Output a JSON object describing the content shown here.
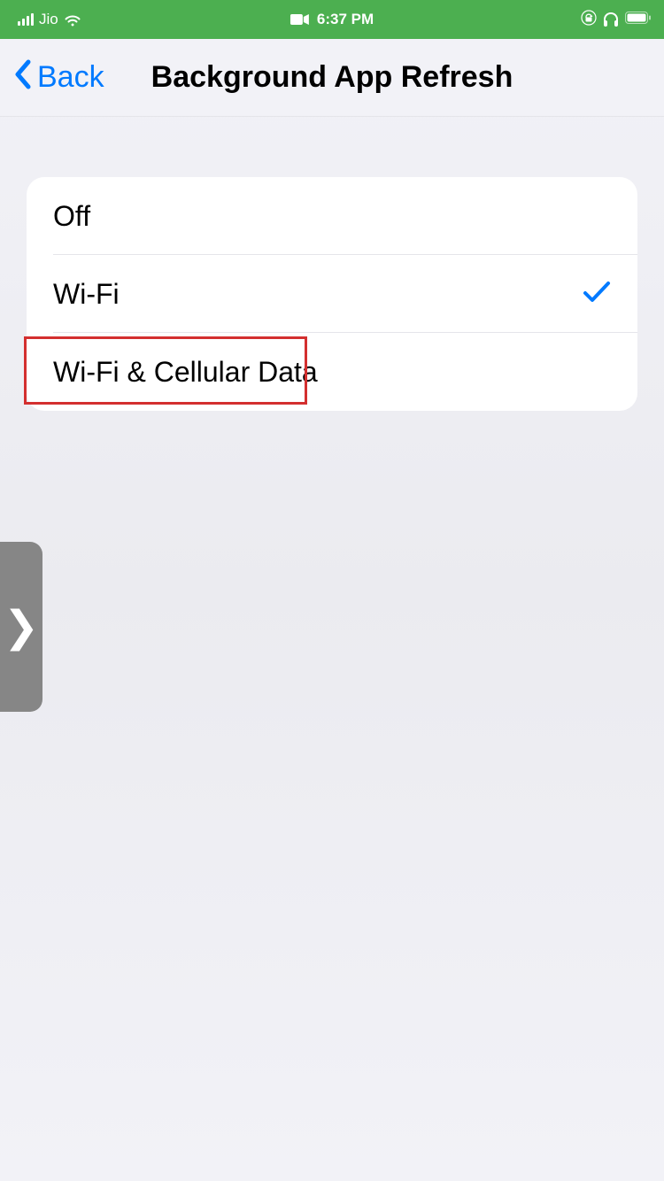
{
  "statusBar": {
    "carrier": "Jio",
    "time": "6:37 PM"
  },
  "nav": {
    "backLabel": "Back",
    "title": "Background App Refresh"
  },
  "options": {
    "items": [
      {
        "label": "Off",
        "selected": false,
        "highlighted": false
      },
      {
        "label": "Wi-Fi",
        "selected": true,
        "highlighted": false
      },
      {
        "label": "Wi-Fi & Cellular Data",
        "selected": false,
        "highlighted": true
      }
    ]
  },
  "sideHandle": {
    "glyph": "❯"
  }
}
